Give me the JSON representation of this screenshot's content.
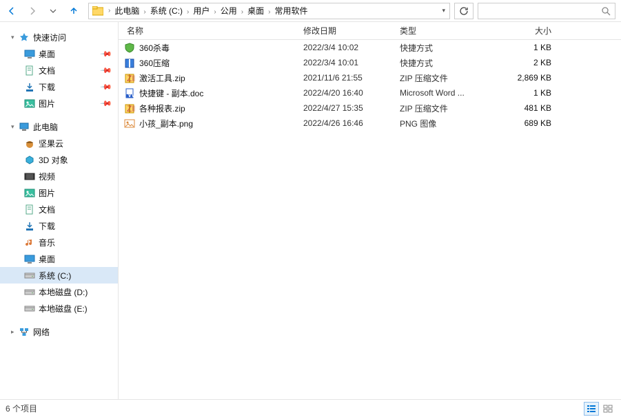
{
  "breadcrumb": [
    "此电脑",
    "系统 (C:)",
    "用户",
    "公用",
    "桌面",
    "常用软件"
  ],
  "sidebar": {
    "quick_access": {
      "label": "快速访问",
      "items": [
        {
          "label": "桌面",
          "icon": "desktop",
          "pinned": true
        },
        {
          "label": "文档",
          "icon": "documents",
          "pinned": true
        },
        {
          "label": "下载",
          "icon": "downloads",
          "pinned": true
        },
        {
          "label": "图片",
          "icon": "pictures",
          "pinned": true
        }
      ]
    },
    "this_pc": {
      "label": "此电脑",
      "items": [
        {
          "label": "坚果云",
          "icon": "nut"
        },
        {
          "label": "3D 对象",
          "icon": "3d"
        },
        {
          "label": "视频",
          "icon": "videos"
        },
        {
          "label": "图片",
          "icon": "pictures"
        },
        {
          "label": "文档",
          "icon": "documents"
        },
        {
          "label": "下载",
          "icon": "downloads"
        },
        {
          "label": "音乐",
          "icon": "music"
        },
        {
          "label": "桌面",
          "icon": "desktop"
        },
        {
          "label": "系统 (C:)",
          "icon": "drive",
          "selected": true
        },
        {
          "label": "本地磁盘 (D:)",
          "icon": "drive"
        },
        {
          "label": "本地磁盘 (E:)",
          "icon": "drive"
        }
      ]
    },
    "network": {
      "label": "网络"
    }
  },
  "columns": {
    "name": "名称",
    "date": "修改日期",
    "type": "类型",
    "size": "大小"
  },
  "files": [
    {
      "name": "360杀毒",
      "date": "2022/3/4 10:02",
      "type": "快捷方式",
      "size": "1 KB",
      "icon": "shield"
    },
    {
      "name": "360压缩",
      "date": "2022/3/4 10:01",
      "type": "快捷方式",
      "size": "2 KB",
      "icon": "zip360"
    },
    {
      "name": "激活工具.zip",
      "date": "2021/11/6 21:55",
      "type": "ZIP 压缩文件",
      "size": "2,869 KB",
      "icon": "zip"
    },
    {
      "name": "快捷键 - 副本.doc",
      "date": "2022/4/20 16:40",
      "type": "Microsoft Word ...",
      "size": "1 KB",
      "icon": "doc"
    },
    {
      "name": "各种报表.zip",
      "date": "2022/4/27 15:35",
      "type": "ZIP 压缩文件",
      "size": "481 KB",
      "icon": "zip"
    },
    {
      "name": "小孩_副本.png",
      "date": "2022/4/26 16:46",
      "type": "PNG 图像",
      "size": "689 KB",
      "icon": "image"
    }
  ],
  "status": {
    "count_label": "6 个项目"
  }
}
